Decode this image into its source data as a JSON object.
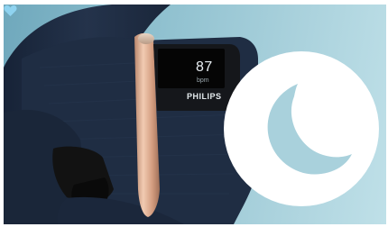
{
  "device": {
    "heart_rate_value": "87",
    "heart_rate_unit": "bpm",
    "brand": "PHILIPS"
  },
  "icons": {
    "heart": "heart-icon",
    "sleep": "crescent-moon-icon"
  },
  "colors": {
    "background": "#8dbfce",
    "strap": "#1f2d43",
    "bezel": "#d9a98f",
    "badge": "#ffffff",
    "moon": "#a9d1dc"
  }
}
